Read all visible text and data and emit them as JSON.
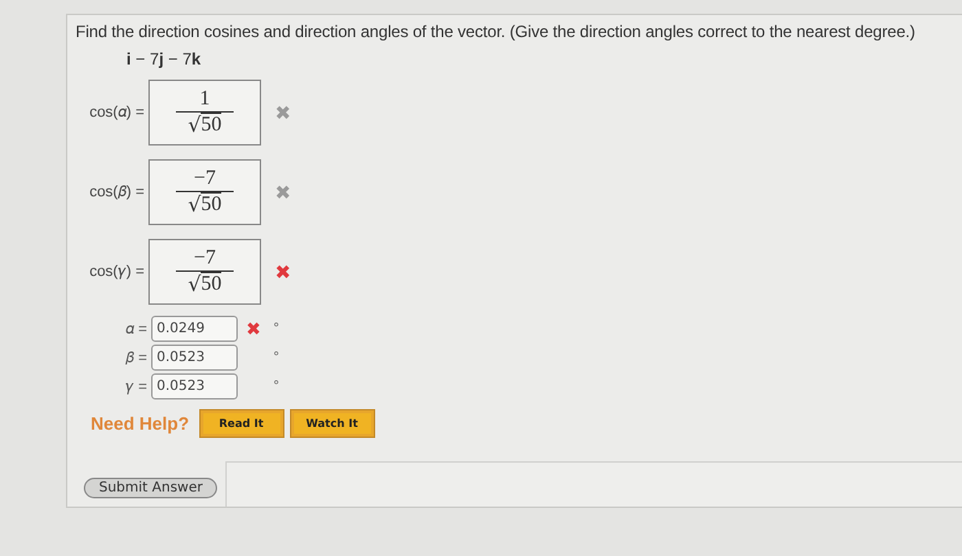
{
  "question": {
    "prompt": "Find the direction cosines and direction angles of the vector. (Give the direction angles correct to the nearest degree.)",
    "vector": "**i** − 7**j** − 7**k**"
  },
  "cosines": [
    {
      "label": "cos(𝛼) =",
      "numerator": "1",
      "radical": "√",
      "radicand": "50",
      "mark": "✖",
      "color": "#9a9a9a"
    },
    {
      "label": "cos(𝛽) =",
      "numerator": "−7",
      "radical": "√",
      "radicand": "50",
      "mark": "✖",
      "color": "#9a9a9a"
    },
    {
      "label": "cos(𝛾) =",
      "numerator": "−7",
      "radical": "√",
      "radicand": "50",
      "mark": "✖",
      "color": "#e0393e"
    }
  ],
  "angles": [
    {
      "label": "𝛼 =",
      "value": "0.0249",
      "mark": "✖",
      "unit": "°"
    },
    {
      "label": "𝛽 =",
      "value": "0.0523",
      "unit": "°"
    },
    {
      "label": "𝛾 =",
      "value": "0.0523",
      "unit": "°"
    }
  ],
  "help": {
    "label": "Need Help?",
    "buttons": [
      "Read It",
      "Watch It"
    ]
  },
  "submit": {
    "label": "Submit Answer"
  }
}
